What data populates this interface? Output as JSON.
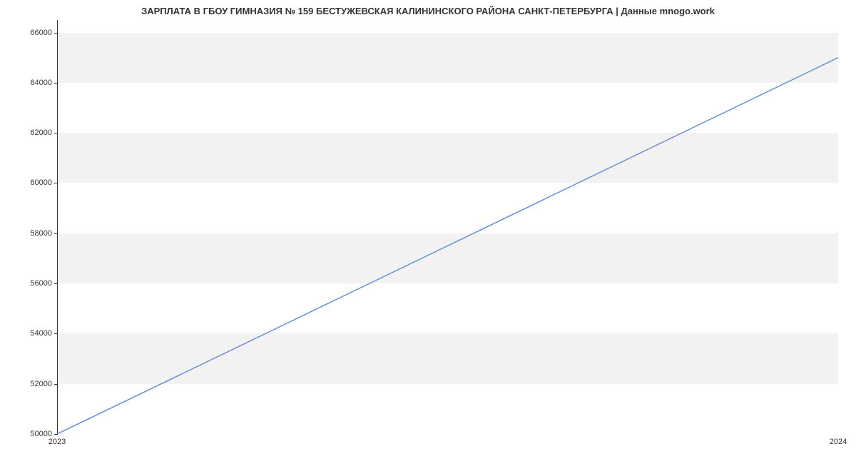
{
  "title": "ЗАРПЛАТА В ГБОУ ГИМНАЗИЯ № 159 БЕСТУЖЕВСКАЯ КАЛИНИНСКОГО РАЙОНА САНКТ-ПЕТЕРБУРГА | Данные mnogo.work",
  "chart_data": {
    "type": "line",
    "x": [
      2023,
      2024
    ],
    "values": [
      50000,
      65000
    ],
    "title": "ЗАРПЛАТА В ГБОУ ГИМНАЗИЯ № 159 БЕСТУЖЕВСКАЯ КАЛИНИНСКОГО РАЙОНА САНКТ-ПЕТЕРБУРГА | Данные mnogo.work",
    "xlabel": "",
    "ylabel": "",
    "ylim": [
      50000,
      66500
    ],
    "yticks": [
      50000,
      52000,
      54000,
      56000,
      58000,
      60000,
      62000,
      64000,
      66000
    ],
    "xticks": [
      2023,
      2024
    ],
    "line_color": "#6b8fd4"
  }
}
